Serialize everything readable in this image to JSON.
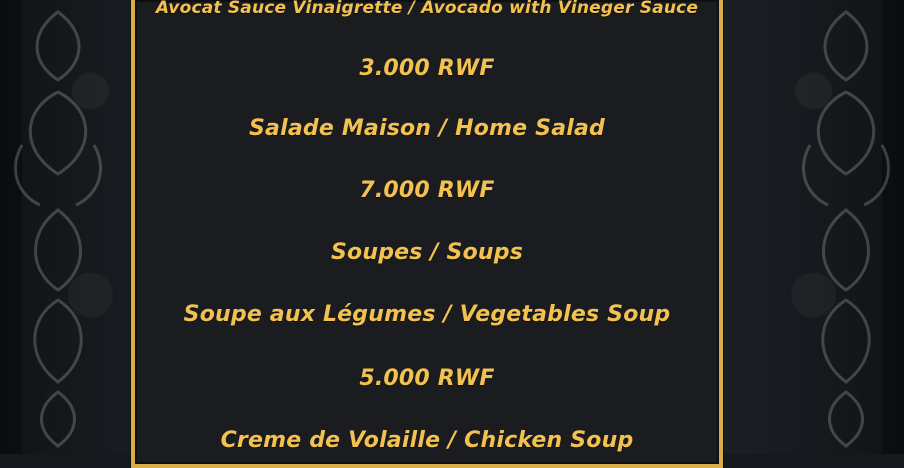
{
  "menu": {
    "items": [
      "Avocat Sauce Vinaigrette / Avocado with Vineger Sauce",
      "3.000 RWF",
      "Salade Maison / Home Salad",
      "7.000 RWF",
      "Soupes / Soups",
      "Soupe aux Légumes / Vegetables Soup",
      "5.000 RWF",
      "Creme de Volaille / Chicken Soup"
    ]
  },
  "theme": {
    "gold": "#d8ad47",
    "text": "#f2c14f",
    "background": "#15181c"
  }
}
